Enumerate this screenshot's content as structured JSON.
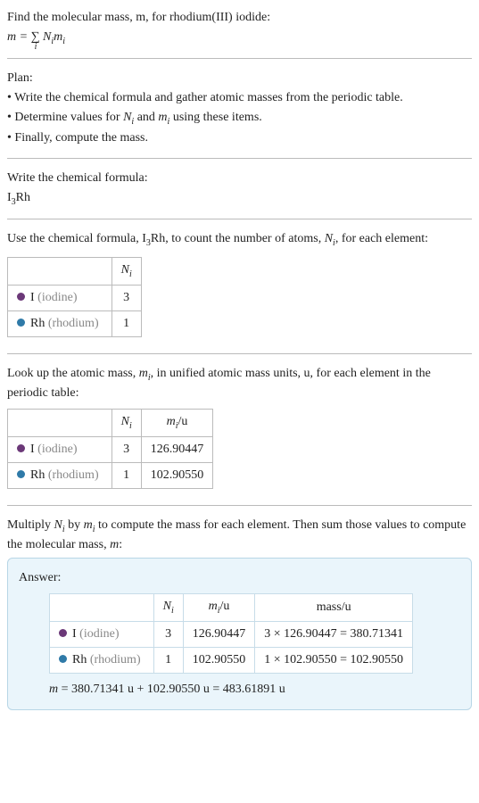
{
  "intro": {
    "title": "Find the molecular mass, m, for rhodium(III) iodide:",
    "formula_lhs": "m = ",
    "formula_sum": "∑",
    "formula_sub": "i",
    "formula_rhs0": "N",
    "formula_rhs1": "i",
    "formula_rhs2": "m",
    "formula_rhs3": "i"
  },
  "plan": {
    "heading": "Plan:",
    "bullet1": "• Write the chemical formula and gather atomic masses from the periodic table.",
    "bullet2_a": "• Determine values for ",
    "bullet2_b": "N",
    "bullet2_c": "i",
    "bullet2_d": " and ",
    "bullet2_e": "m",
    "bullet2_f": "i",
    "bullet2_g": " using these items.",
    "bullet3": "• Finally, compute the mass."
  },
  "formula_step": {
    "heading": "Write the chemical formula:",
    "value_a": "I",
    "value_b": "3",
    "value_c": "Rh"
  },
  "count_step": {
    "text_a": "Use the chemical formula, I",
    "text_b": "3",
    "text_c": "Rh, to count the number of atoms, ",
    "text_d": "N",
    "text_e": "i",
    "text_f": ", for each element:",
    "col_n_a": "N",
    "col_n_b": "i",
    "row1_el_a": "I ",
    "row1_el_b": "(iodine)",
    "row1_n": "3",
    "row2_el_a": "Rh ",
    "row2_el_b": "(rhodium)",
    "row2_n": "1"
  },
  "mass_step": {
    "text_a": "Look up the atomic mass, ",
    "text_b": "m",
    "text_c": "i",
    "text_d": ", in unified atomic mass units, u, for each element in the periodic table:",
    "col_n_a": "N",
    "col_n_b": "i",
    "col_m_a": "m",
    "col_m_b": "i",
    "col_m_c": "/u",
    "row1_el_a": "I ",
    "row1_el_b": "(iodine)",
    "row1_n": "3",
    "row1_m": "126.90447",
    "row2_el_a": "Rh ",
    "row2_el_b": "(rhodium)",
    "row2_n": "1",
    "row2_m": "102.90550"
  },
  "compute_step": {
    "text_a": "Multiply ",
    "text_b": "N",
    "text_c": "i",
    "text_d": " by ",
    "text_e": "m",
    "text_f": "i",
    "text_g": " to compute the mass for each element. Then sum those values to compute the molecular mass, ",
    "text_h": "m",
    "text_i": ":"
  },
  "answer": {
    "label": "Answer:",
    "col_n_a": "N",
    "col_n_b": "i",
    "col_m_a": "m",
    "col_m_b": "i",
    "col_m_c": "/u",
    "col_mass": "mass/u",
    "row1_el_a": "I ",
    "row1_el_b": "(iodine)",
    "row1_n": "3",
    "row1_m": "126.90447",
    "row1_mass": "3 × 126.90447 = 380.71341",
    "row2_el_a": "Rh ",
    "row2_el_b": "(rhodium)",
    "row2_n": "1",
    "row2_m": "102.90550",
    "row2_mass": "1 × 102.90550 = 102.90550",
    "final_a": "m",
    "final_b": " = 380.71341 u + 102.90550 u = 483.61891 u"
  }
}
